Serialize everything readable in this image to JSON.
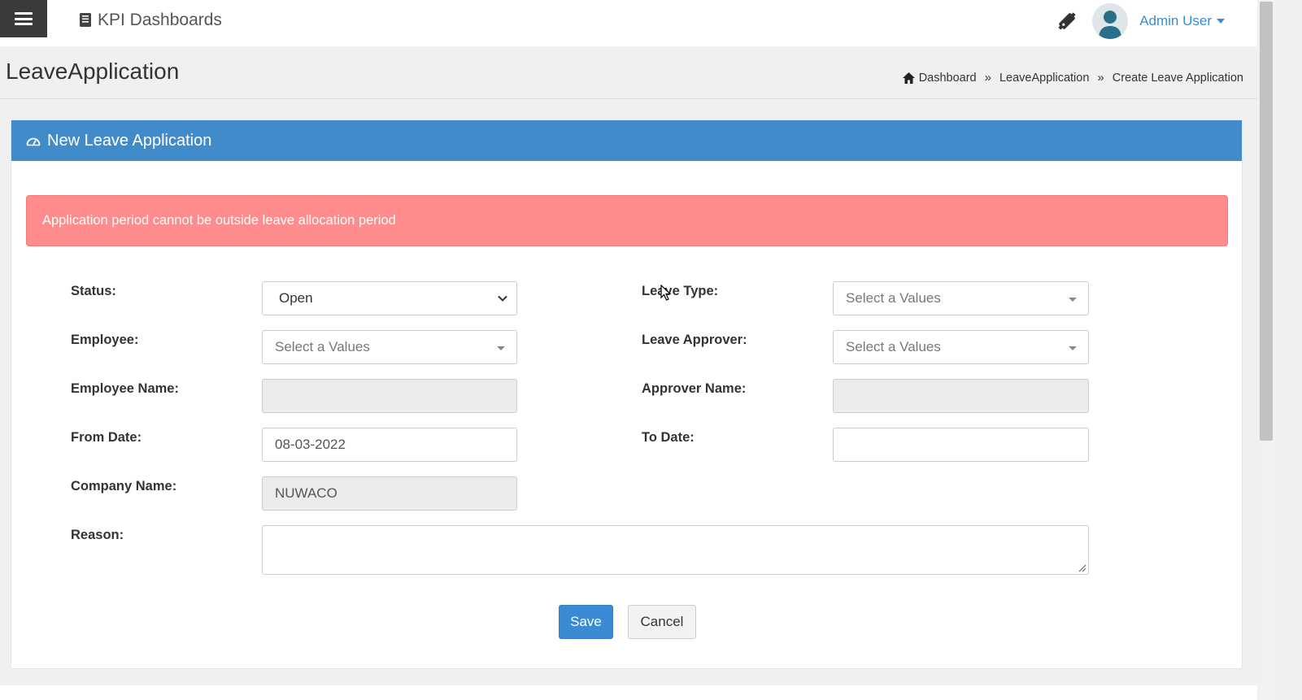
{
  "navbar": {
    "brand": "KPI Dashboards",
    "user_name": "Admin User"
  },
  "page": {
    "title": "LeaveApplication",
    "breadcrumb": [
      "Dashboard",
      "LeaveApplication",
      "Create Leave Application"
    ]
  },
  "panel": {
    "heading": "New Leave Application",
    "alert": "Application period cannot be outside leave allocation period"
  },
  "form": {
    "status": {
      "label": "Status:",
      "value": "Open"
    },
    "leave_type": {
      "label": "Leave Type:",
      "placeholder": "Select a Values"
    },
    "employee": {
      "label": "Employee:",
      "placeholder": "Select a Values"
    },
    "leave_approver": {
      "label": "Leave Approver:",
      "placeholder": "Select a Values"
    },
    "employee_name": {
      "label": "Employee Name:",
      "value": ""
    },
    "approver_name": {
      "label": "Approver Name:",
      "value": ""
    },
    "from_date": {
      "label": "From Date:",
      "value": "08-03-2022"
    },
    "to_date": {
      "label": "To Date:",
      "value": ""
    },
    "company_name": {
      "label": "Company Name:",
      "value": "NUWACO"
    },
    "reason": {
      "label": "Reason:",
      "value": ""
    }
  },
  "actions": {
    "save": "Save",
    "cancel": "Cancel"
  },
  "colors": {
    "panel_heading": "#428bca",
    "alert_bg": "#ff8c8c",
    "primary_button": "#3b8bd4",
    "user_link": "#3b8bd4"
  }
}
